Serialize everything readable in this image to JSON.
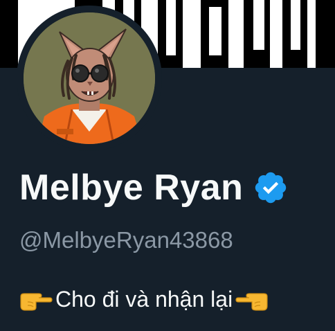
{
  "profile": {
    "display_name": "Melbye Ryan",
    "handle": "@MelbyeRyan43868",
    "bio": "Cho đi và nhận lại",
    "verified": true,
    "bio_leading_icon": "hand-pointing-right-icon",
    "bio_trailing_icon": "hand-pointing-left-icon",
    "avatar_icon": "cat-with-sunglasses-avatar"
  },
  "colors": {
    "background": "#15202b",
    "display_name": "#f7f9f9",
    "handle": "#8b98a5",
    "verified_badge": "#1d9bf0",
    "banner_light": "#ffffff",
    "banner_dark": "#000000"
  }
}
